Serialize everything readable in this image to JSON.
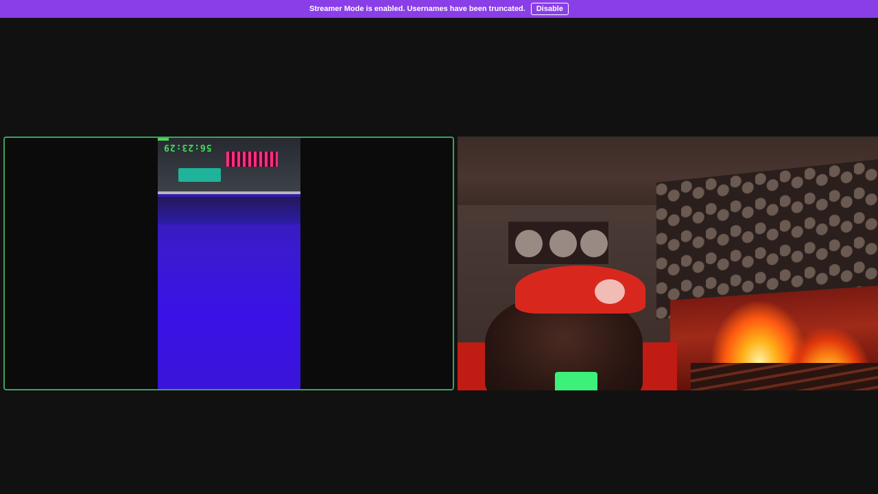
{
  "banner": {
    "message": "Streamer Mode is enabled. Usernames have been truncated.",
    "disable_label": "Disable",
    "color": "#8a3ee8"
  },
  "streams": [
    {
      "id": "left",
      "speaking": true,
      "border_color": "#3ba55d",
      "overlay_text": "56:23:29"
    },
    {
      "id": "right",
      "speaking": false
    }
  ]
}
